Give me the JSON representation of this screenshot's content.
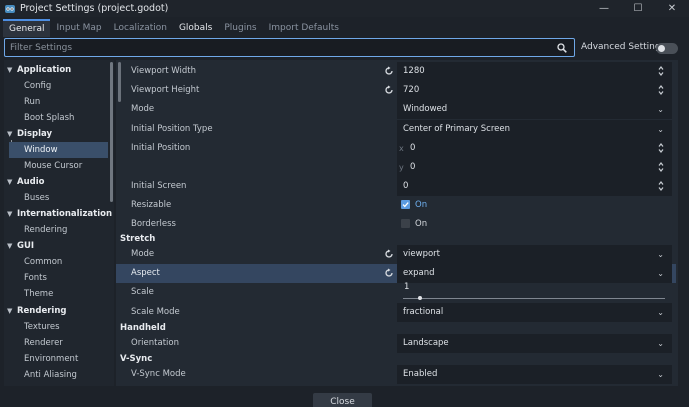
{
  "window": {
    "title": "Project Settings (project.godot)",
    "minimize": "—",
    "maximize": "☐",
    "close": "✕"
  },
  "tabs": [
    {
      "label": "General",
      "active": true
    },
    {
      "label": "Input Map"
    },
    {
      "label": "Localization"
    },
    {
      "label": "Globals"
    },
    {
      "label": "Plugins"
    },
    {
      "label": "Import Defaults"
    }
  ],
  "filter": {
    "placeholder": "Filter Settings"
  },
  "advanced": {
    "label": "Advanced Settings",
    "enabled": false
  },
  "sidebar": {
    "items": [
      {
        "label": "Application",
        "type": "category"
      },
      {
        "label": "Config",
        "type": "leaf"
      },
      {
        "label": "Run",
        "type": "leaf"
      },
      {
        "label": "Boot Splash",
        "type": "leaf"
      },
      {
        "label": "Display",
        "type": "category"
      },
      {
        "label": "Window",
        "type": "leaf",
        "selected": true
      },
      {
        "label": "Mouse Cursor",
        "type": "leaf"
      },
      {
        "label": "Audio",
        "type": "category"
      },
      {
        "label": "Buses",
        "type": "leaf"
      },
      {
        "label": "Internationalization",
        "type": "category"
      },
      {
        "label": "Rendering",
        "type": "leaf"
      },
      {
        "label": "GUI",
        "type": "category"
      },
      {
        "label": "Common",
        "type": "leaf"
      },
      {
        "label": "Fonts",
        "type": "leaf"
      },
      {
        "label": "Theme",
        "type": "leaf"
      },
      {
        "label": "Rendering",
        "type": "category"
      },
      {
        "label": "Textures",
        "type": "leaf"
      },
      {
        "label": "Renderer",
        "type": "leaf"
      },
      {
        "label": "Environment",
        "type": "leaf"
      },
      {
        "label": "Anti Aliasing",
        "type": "leaf"
      }
    ]
  },
  "settings": {
    "viewport_width": {
      "label": "Viewport Width",
      "value": "1280"
    },
    "viewport_height": {
      "label": "Viewport Height",
      "value": "720"
    },
    "mode": {
      "label": "Mode",
      "value": "Windowed"
    },
    "initial_position_type": {
      "label": "Initial Position Type",
      "value": "Center of Primary Screen"
    },
    "initial_position": {
      "label": "Initial Position",
      "x_axis": "x",
      "x": "0",
      "y_axis": "y",
      "y": "0"
    },
    "initial_screen": {
      "label": "Initial Screen",
      "value": "0"
    },
    "resizable": {
      "label": "Resizable",
      "value": "On",
      "checked": true
    },
    "borderless": {
      "label": "Borderless",
      "value": "On",
      "checked": false
    },
    "stretch": {
      "heading": "Stretch",
      "mode": {
        "label": "Mode",
        "value": "viewport"
      },
      "aspect": {
        "label": "Aspect",
        "value": "expand"
      },
      "scale": {
        "label": "Scale",
        "value": "1"
      },
      "scale_mode": {
        "label": "Scale Mode",
        "value": "fractional"
      }
    },
    "handheld": {
      "heading": "Handheld",
      "orientation": {
        "label": "Orientation",
        "value": "Landscape"
      }
    },
    "vsync": {
      "heading": "V-Sync",
      "mode": {
        "label": "V-Sync Mode",
        "value": "Enabled"
      }
    }
  },
  "footer": {
    "close_label": "Close"
  },
  "colors": {
    "accent": "#4d8ee2",
    "selection": "#344660",
    "check_on": "#5c9be0"
  }
}
